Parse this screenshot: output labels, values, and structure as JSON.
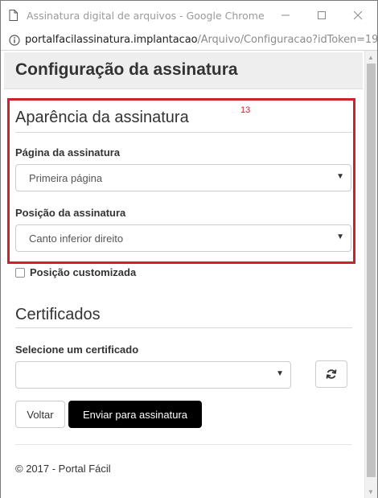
{
  "window": {
    "title": "Assinatura digital de arquivos - Google Chrome",
    "minimize_glyph": "—",
    "maximize_glyph": "☐",
    "close_glyph": "✕"
  },
  "address": {
    "host": "portalfacilassinatura.implantacao",
    "path": "/Arquivo/Configuracao?idToken=19..."
  },
  "page": {
    "title": "Configuração da assinatura"
  },
  "appearance": {
    "section_title": "Aparência da assinatura",
    "annotation": "13",
    "page_label": "Página da assinatura",
    "page_selected": "Primeira página",
    "position_label": "Posição da assinatura",
    "position_selected": "Canto inferior direito",
    "custom_position_label": "Posição customizada",
    "custom_position_checked": false
  },
  "certificates": {
    "section_title": "Certificados",
    "select_label": "Selecione um certificado",
    "selected": ""
  },
  "actions": {
    "back_label": "Voltar",
    "submit_label": "Enviar para assinatura"
  },
  "footer": {
    "text": "© 2017 - Portal Fácil"
  },
  "colors": {
    "highlight": "#d0202a",
    "primary_button": "#000000",
    "header_band": "#eeeeee"
  },
  "icons": {
    "page": "document-icon",
    "security": "info-icon",
    "dropdown": "caret-down-icon",
    "refresh": "refresh-icon"
  }
}
